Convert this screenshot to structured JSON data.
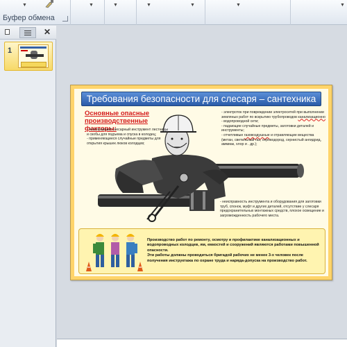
{
  "ribbon": {
    "clipboard_group_label": "Буфер обмена"
  },
  "left_pane": {
    "slide_number": "1"
  },
  "slide": {
    "title": "Требования безопасности для слесаря – сантехника",
    "hazard_heading": "Основные опасные производственные факторы:",
    "left_list": [
      "- неисправный слесарный инструмент лестницы и скобы для подъема и спуска в колодец;",
      "- применяющиеся случайные предметы для открытия крышек люков колодцев;"
    ],
    "right_list_1": "- электроток при повреждении электросетей при выполнении земляных работ по вскрытию трубопроводов",
    "right_list_1_wavy": "канализационно",
    "right_list_1_end": "- водопроводной сети;",
    "right_list_2": "- падающие случайные предметы, заготовки деталей и инструменты;",
    "right_list_3_start": "- отчетливые",
    "right_list_3_wavy": "газовоздушные",
    "right_list_3_end": "и отравляющие вещества (метан, светильный газ, сероводород, сернистый ангидрид, аммиак, хлор и . др.);",
    "bottom_right_list": "- неисправность инструмента и оборудования для заготовки труб, спонок, муфт и других деталей, отсутствие у слесаря предохранительных монтажных средств, плохое освещение и загроможденность рабочего места.",
    "workers_text_1": "Производство работ по ремонту, осмотру и профилактике канализационных и водопроводных колодцев, ям, емкостей и сооружений являются работами повышенной опасности.",
    "workers_text_2": "Эти работы должны проводиться бригадой рабочих не менее 3-х человек после получения инструктажа по охране труда и наряда-допуска на производство работ."
  },
  "colors": {
    "title_bar": "#2a5ba8",
    "hazard_heading": "#d41b1b",
    "slide_border": "#ffd46a",
    "thumb_selected": "#f7d968"
  }
}
